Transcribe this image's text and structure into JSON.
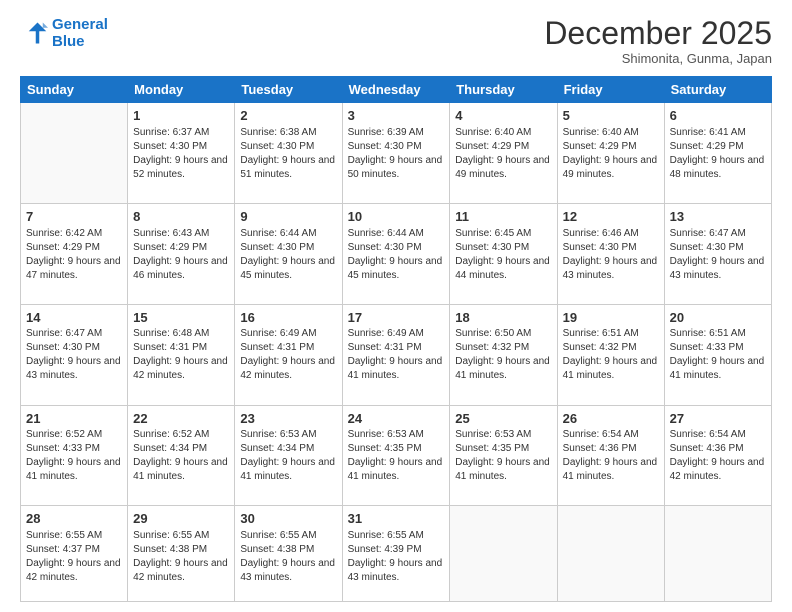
{
  "header": {
    "logo_line1": "General",
    "logo_line2": "Blue",
    "month": "December 2025",
    "location": "Shimonita, Gunma, Japan"
  },
  "weekdays": [
    "Sunday",
    "Monday",
    "Tuesday",
    "Wednesday",
    "Thursday",
    "Friday",
    "Saturday"
  ],
  "weeks": [
    [
      {
        "day": null
      },
      {
        "day": 1,
        "sunrise": "6:37 AM",
        "sunset": "4:30 PM",
        "daylight": "9 hours and 52 minutes."
      },
      {
        "day": 2,
        "sunrise": "6:38 AM",
        "sunset": "4:30 PM",
        "daylight": "9 hours and 51 minutes."
      },
      {
        "day": 3,
        "sunrise": "6:39 AM",
        "sunset": "4:30 PM",
        "daylight": "9 hours and 50 minutes."
      },
      {
        "day": 4,
        "sunrise": "6:40 AM",
        "sunset": "4:29 PM",
        "daylight": "9 hours and 49 minutes."
      },
      {
        "day": 5,
        "sunrise": "6:40 AM",
        "sunset": "4:29 PM",
        "daylight": "9 hours and 49 minutes."
      },
      {
        "day": 6,
        "sunrise": "6:41 AM",
        "sunset": "4:29 PM",
        "daylight": "9 hours and 48 minutes."
      }
    ],
    [
      {
        "day": 7,
        "sunrise": "6:42 AM",
        "sunset": "4:29 PM",
        "daylight": "9 hours and 47 minutes."
      },
      {
        "day": 8,
        "sunrise": "6:43 AM",
        "sunset": "4:29 PM",
        "daylight": "9 hours and 46 minutes."
      },
      {
        "day": 9,
        "sunrise": "6:44 AM",
        "sunset": "4:30 PM",
        "daylight": "9 hours and 45 minutes."
      },
      {
        "day": 10,
        "sunrise": "6:44 AM",
        "sunset": "4:30 PM",
        "daylight": "9 hours and 45 minutes."
      },
      {
        "day": 11,
        "sunrise": "6:45 AM",
        "sunset": "4:30 PM",
        "daylight": "9 hours and 44 minutes."
      },
      {
        "day": 12,
        "sunrise": "6:46 AM",
        "sunset": "4:30 PM",
        "daylight": "9 hours and 43 minutes."
      },
      {
        "day": 13,
        "sunrise": "6:47 AM",
        "sunset": "4:30 PM",
        "daylight": "9 hours and 43 minutes."
      }
    ],
    [
      {
        "day": 14,
        "sunrise": "6:47 AM",
        "sunset": "4:30 PM",
        "daylight": "9 hours and 43 minutes."
      },
      {
        "day": 15,
        "sunrise": "6:48 AM",
        "sunset": "4:31 PM",
        "daylight": "9 hours and 42 minutes."
      },
      {
        "day": 16,
        "sunrise": "6:49 AM",
        "sunset": "4:31 PM",
        "daylight": "9 hours and 42 minutes."
      },
      {
        "day": 17,
        "sunrise": "6:49 AM",
        "sunset": "4:31 PM",
        "daylight": "9 hours and 41 minutes."
      },
      {
        "day": 18,
        "sunrise": "6:50 AM",
        "sunset": "4:32 PM",
        "daylight": "9 hours and 41 minutes."
      },
      {
        "day": 19,
        "sunrise": "6:51 AM",
        "sunset": "4:32 PM",
        "daylight": "9 hours and 41 minutes."
      },
      {
        "day": 20,
        "sunrise": "6:51 AM",
        "sunset": "4:33 PM",
        "daylight": "9 hours and 41 minutes."
      }
    ],
    [
      {
        "day": 21,
        "sunrise": "6:52 AM",
        "sunset": "4:33 PM",
        "daylight": "9 hours and 41 minutes."
      },
      {
        "day": 22,
        "sunrise": "6:52 AM",
        "sunset": "4:34 PM",
        "daylight": "9 hours and 41 minutes."
      },
      {
        "day": 23,
        "sunrise": "6:53 AM",
        "sunset": "4:34 PM",
        "daylight": "9 hours and 41 minutes."
      },
      {
        "day": 24,
        "sunrise": "6:53 AM",
        "sunset": "4:35 PM",
        "daylight": "9 hours and 41 minutes."
      },
      {
        "day": 25,
        "sunrise": "6:53 AM",
        "sunset": "4:35 PM",
        "daylight": "9 hours and 41 minutes."
      },
      {
        "day": 26,
        "sunrise": "6:54 AM",
        "sunset": "4:36 PM",
        "daylight": "9 hours and 41 minutes."
      },
      {
        "day": 27,
        "sunrise": "6:54 AM",
        "sunset": "4:36 PM",
        "daylight": "9 hours and 42 minutes."
      }
    ],
    [
      {
        "day": 28,
        "sunrise": "6:55 AM",
        "sunset": "4:37 PM",
        "daylight": "9 hours and 42 minutes."
      },
      {
        "day": 29,
        "sunrise": "6:55 AM",
        "sunset": "4:38 PM",
        "daylight": "9 hours and 42 minutes."
      },
      {
        "day": 30,
        "sunrise": "6:55 AM",
        "sunset": "4:38 PM",
        "daylight": "9 hours and 43 minutes."
      },
      {
        "day": 31,
        "sunrise": "6:55 AM",
        "sunset": "4:39 PM",
        "daylight": "9 hours and 43 minutes."
      },
      {
        "day": null
      },
      {
        "day": null
      },
      {
        "day": null
      }
    ]
  ]
}
